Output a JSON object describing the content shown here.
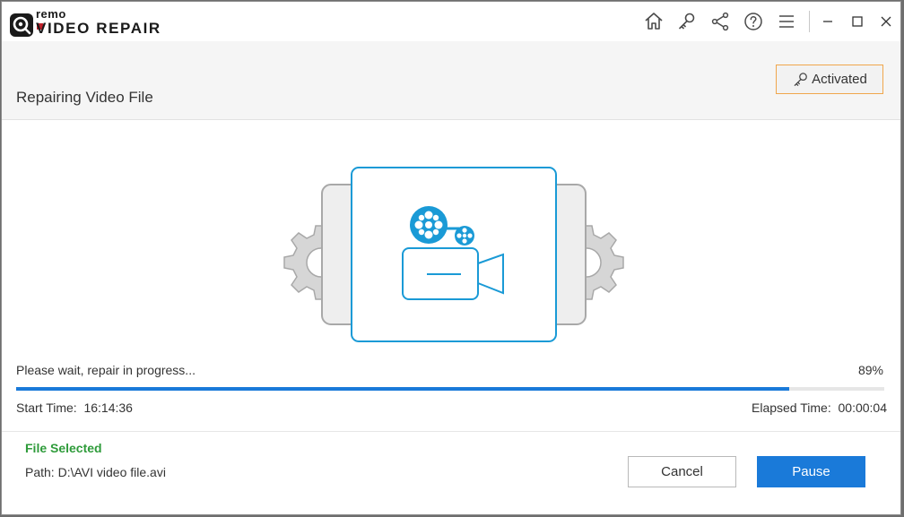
{
  "app": {
    "logo_top": "remo",
    "logo_product": "VIDEO REPAIR"
  },
  "titlebar": {
    "icons": [
      "home-icon",
      "key-icon",
      "share-icon",
      "help-icon",
      "menu-icon"
    ],
    "window_controls": [
      "minimize-icon",
      "maximize-icon",
      "close-icon"
    ]
  },
  "header": {
    "title": "Repairing Video File",
    "activated_label": "Activated"
  },
  "progress": {
    "message": "Please wait, repair in progress...",
    "percent_label": "89%",
    "percent": 89
  },
  "times": {
    "start_label": "Start Time:",
    "start_value": "16:14:36",
    "elapsed_label": "Elapsed Time:",
    "elapsed_value": "00:00:04"
  },
  "file": {
    "status": "File Selected",
    "path_label": "Path:",
    "path_value": "D:\\AVI video file.avi"
  },
  "buttons": {
    "cancel": "Cancel",
    "pause": "Pause"
  },
  "colors": {
    "accent": "#1a7ad9",
    "illustration": "#1a9ad6",
    "success": "#2e9b3a",
    "activated_border": "#f0a64c",
    "gear_gray": "#d0d0d0"
  }
}
